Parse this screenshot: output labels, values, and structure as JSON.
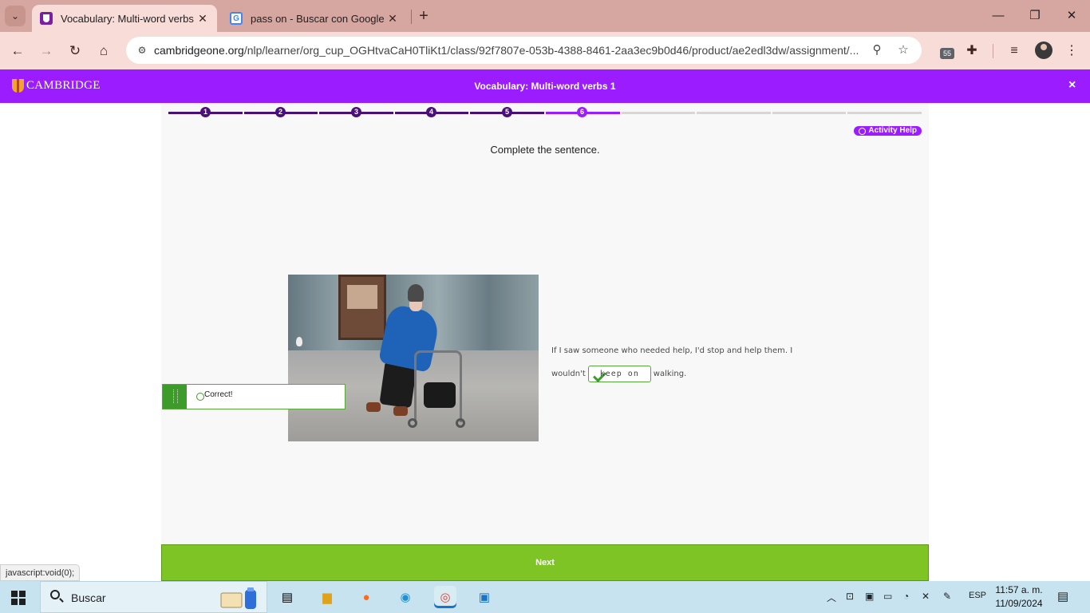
{
  "browser": {
    "tabs": [
      {
        "title": "Vocabulary: Multi-word verbs 1",
        "active": true,
        "favicon": "cambridge-favicon"
      },
      {
        "title": "pass on - Buscar con Google",
        "active": false,
        "favicon": "google-favicon"
      }
    ],
    "tab_close_glyph": "✕",
    "url_domain": "cambridgeone.org",
    "url_path": "/nlp/learner/org_cup_OGHtvaCaH0TliKt1/class/92f7807e-053b-4388-8461-2aa3ec9b0d46/product/ae2edl3dw/assignment/...",
    "extension_badge": "55",
    "status_link": "javascript:void(0);"
  },
  "app": {
    "brand": "CAMBRIDGE",
    "title": "Vocabulary: Multi-word verbs 1",
    "close_glyph": "×",
    "accent_color": "#9b1dff",
    "success_color": "#7ec425"
  },
  "progress": {
    "steps": [
      "1",
      "2",
      "3",
      "4",
      "5",
      "6"
    ],
    "current_step": 6,
    "total_segments": 10
  },
  "activity": {
    "help_label": "Activity Help",
    "instruction": "Complete the sentence.",
    "sentence_before": "If I saw someone who needed help, I'd stop and help them. I wouldn't",
    "answer": "keep on",
    "sentence_after": "walking.",
    "feedback": "Correct!",
    "next_label": "Next"
  },
  "taskbar": {
    "search_label": "Buscar",
    "language": "ESP",
    "time": "11:57 a. m.",
    "date": "11/09/2024"
  }
}
